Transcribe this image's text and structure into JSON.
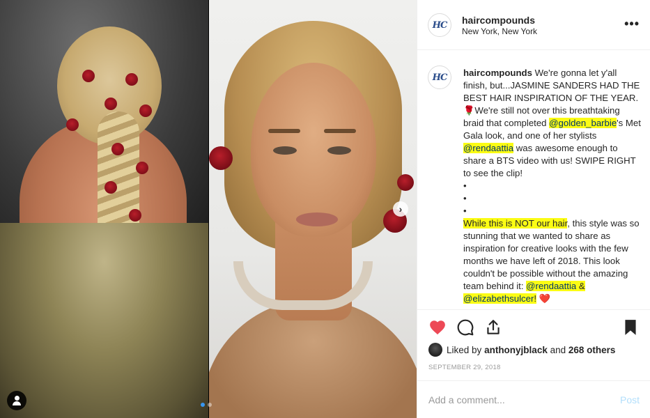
{
  "post": {
    "username": "haircompounds",
    "location": "New York, New York",
    "avatar_logo": "HC"
  },
  "caption": {
    "username": "haircompounds",
    "text_part1": "We're gonna let y'all finish, but...JASMINE SANDERS HAD THE BEST HAIR INSPIRATION OF THE YEAR. ",
    "rose_emoji": "🌹",
    "text_part2": "We're still not over this breathtaking braid that completed ",
    "mention1": "@golden_barbie",
    "text_part3": "'s Met Gala look, and one of her stylists ",
    "mention2": "@rendaattia",
    "text_part4": " was awesome enough to share a BTS video with us! SWIPE RIGHT to see the clip!",
    "bullets": [
      "•",
      "•",
      "•"
    ],
    "highlight1": "While this is NOT our hair",
    "text_part5": ", this style was so stunning that we wanted to share as inspiration for creative looks with the few months we have left of 2018. This look couldn't be possible without the amazing team behind it: ",
    "mention3": "@rendaattia",
    "amp": " & ",
    "mention4": "@elizabethsulcer",
    "exclaim": "!",
    "heart_emoji": "❤️"
  },
  "likes": {
    "prefix": "Liked by",
    "user": "anthonyjblack",
    "and": "and",
    "count_text": "268 others"
  },
  "date": "SEPTEMBER 29, 2018",
  "comment": {
    "placeholder": "Add a comment...",
    "post_label": "Post"
  },
  "media": {
    "next_glyph": "›"
  },
  "colors": {
    "liked_heart": "#ed4956",
    "highlight": "#fbfc14",
    "link": "#003569",
    "post_button": "#b2dffc"
  }
}
